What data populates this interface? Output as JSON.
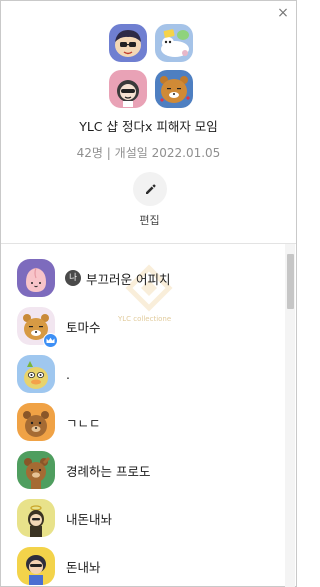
{
  "window": {
    "close_glyph": "×"
  },
  "room": {
    "title": "YLC 샵 정다x 피해자 모임",
    "member_count": "42명",
    "separator": "|",
    "opened": "개설일 2022.01.05",
    "edit_label": "편집"
  },
  "members": [
    {
      "name": "부끄러운 어피치",
      "is_me": true,
      "me_badge": "나",
      "avatar": "apeach"
    },
    {
      "name": "토마수",
      "is_host": true,
      "avatar": "ryan-orange"
    },
    {
      "name": ".",
      "avatar": "tube-blue"
    },
    {
      "name": "ㄱㄴㄷ",
      "avatar": "frodo-orange"
    },
    {
      "name": "경례하는 프로도",
      "avatar": "frodo-green"
    },
    {
      "name": "내돈내놔",
      "avatar": "neo-yellow"
    },
    {
      "name": "돈내놔",
      "avatar": "jay-g-yellow"
    }
  ],
  "watermark_text": "YLC collectione",
  "colors": {
    "host_badge": "#3d8ff5",
    "scroll_thumb": "#c6c6c6"
  }
}
